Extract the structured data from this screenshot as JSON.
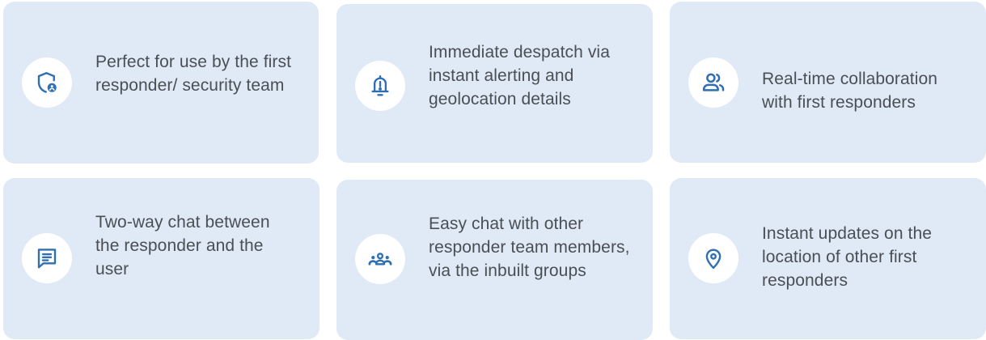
{
  "colors": {
    "card_background": "#dfeaf6",
    "icon_circle": "#ffffff",
    "icon_color": "#2f6fb3",
    "text": "#4a4f55"
  },
  "features": [
    {
      "icon": "shield-user-icon",
      "text": "Perfect for use by the first responder/ security team"
    },
    {
      "icon": "bell-alert-icon",
      "text": "Immediate despatch via instant alerting and geolocation details"
    },
    {
      "icon": "users-icon",
      "text": "Real-time collaboration with first responders"
    },
    {
      "icon": "chat-message-icon",
      "text": "Two-way chat between the responder and the user"
    },
    {
      "icon": "group-icon",
      "text": "Easy chat with other responder team members, via the inbuilt groups"
    },
    {
      "icon": "location-pin-icon",
      "text": "Instant updates on the location of other first responders"
    }
  ]
}
